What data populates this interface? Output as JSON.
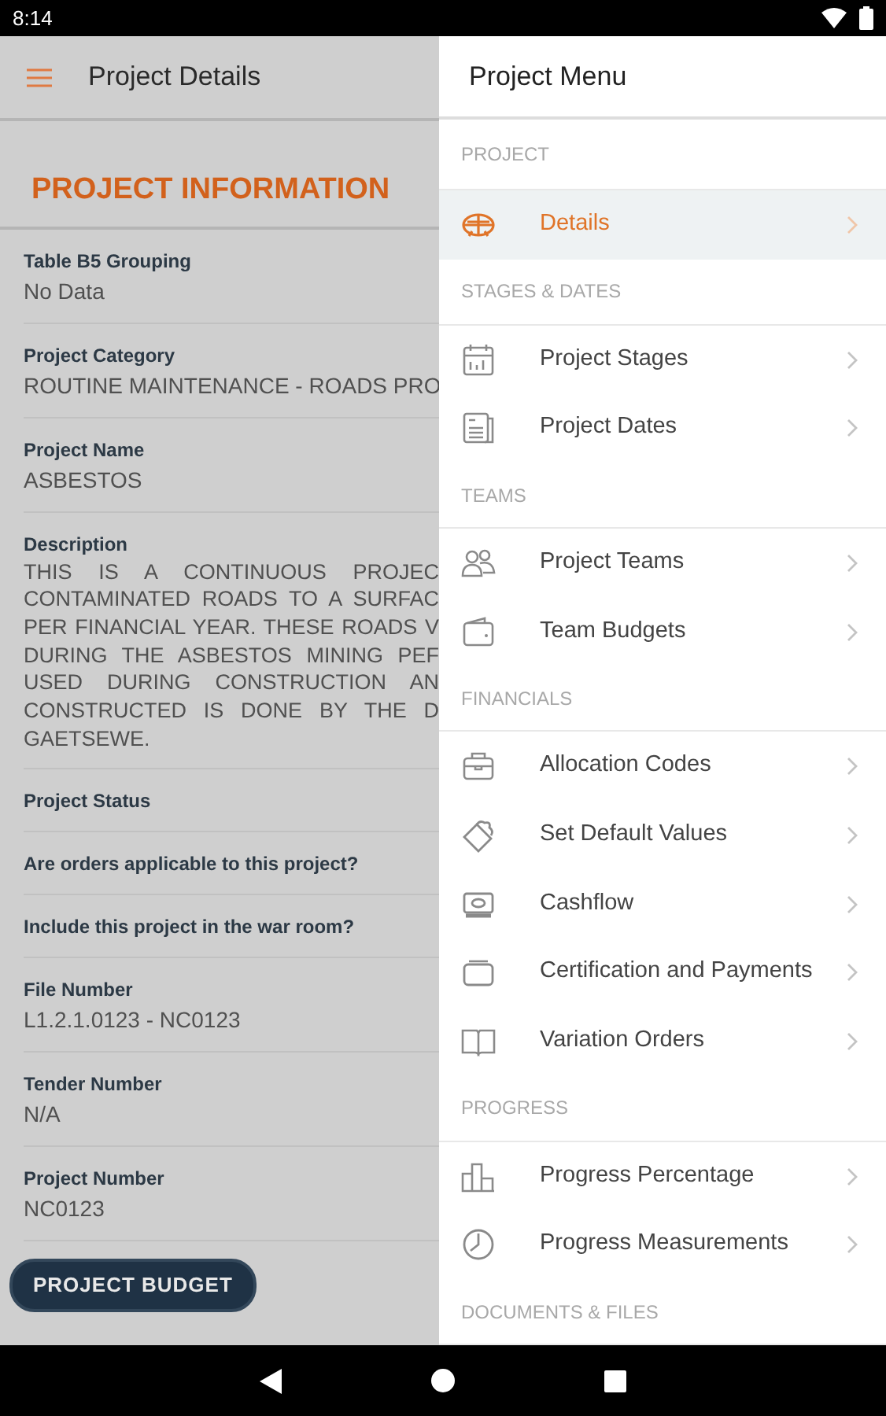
{
  "status_bar": {
    "time": "8:14"
  },
  "app_bar": {
    "title": "Project Details"
  },
  "section_title": "PROJECT INFORMATION",
  "fields": [
    {
      "label": "Table B5 Grouping",
      "value": "No Data"
    },
    {
      "label": "Project Category",
      "value": "ROUTINE MAINTENANCE - ROADS PRO"
    },
    {
      "label": "Project Name",
      "value": "ASBESTOS"
    },
    {
      "label": "Description",
      "lines": [
        "THIS IS A CONTINUOUS PROJEC",
        "CONTAMINATED ROADS TO A SURFAC",
        "PER FINANCIAL YEAR. THESE ROADS V",
        "DURING THE ASBESTOS MINING PEF",
        "USED DURING CONSTRUCTION AN",
        "CONSTRUCTED IS DONE BY THE D",
        "GAETSEWE."
      ]
    },
    {
      "label": "Project Status"
    },
    {
      "label": "Are orders applicable to this project?"
    },
    {
      "label": "Include this project in the war room?"
    },
    {
      "label": "File Number",
      "value": "L1.2.1.0123 - NC0123"
    },
    {
      "label": "Tender Number",
      "value": "N/A"
    },
    {
      "label": "Project Number",
      "value": "NC0123"
    }
  ],
  "budget_button": "PROJECT BUDGET",
  "drawer": {
    "title": "Project Menu",
    "sections": [
      {
        "header": "PROJECT",
        "items": [
          {
            "label": "Details",
            "selected": true
          }
        ]
      },
      {
        "header": "STAGES & DATES",
        "items": [
          {
            "label": "Project Stages",
            "selected": false
          },
          {
            "label": "Project Dates",
            "selected": false
          }
        ]
      },
      {
        "header": "TEAMS",
        "items": [
          {
            "label": "Project Teams",
            "selected": false
          },
          {
            "label": "Team Budgets",
            "selected": false
          }
        ]
      },
      {
        "header": "FINANCIALS",
        "items": [
          {
            "label": "Allocation Codes",
            "selected": false
          },
          {
            "label": "Set Default Values",
            "selected": false
          },
          {
            "label": "Cashflow",
            "selected": false
          },
          {
            "label": "Certification and Payments",
            "selected": false
          },
          {
            "label": "Variation Orders",
            "selected": false
          }
        ]
      },
      {
        "header": "PROGRESS",
        "items": [
          {
            "label": "Progress Percentage",
            "selected": false
          },
          {
            "label": "Progress Measurements",
            "selected": false
          }
        ]
      },
      {
        "header": "DOCUMENTS & FILES"
      }
    ]
  }
}
